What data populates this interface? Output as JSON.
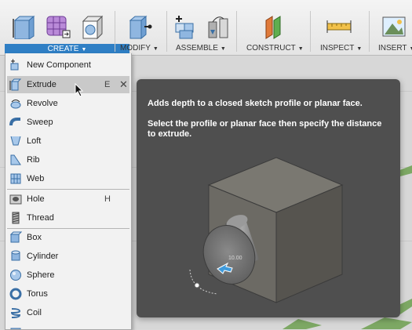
{
  "toolbar": {
    "create_label": "CREATE",
    "modify_label": "MODIFY",
    "assemble_label": "ASSEMBLE",
    "construct_label": "CONSTRUCT",
    "inspect_label": "INSPECT",
    "insert_label": "INSERT",
    "accent_color": "#2f7fc5"
  },
  "menu": {
    "items": [
      {
        "label": "New Component",
        "icon": "new-component-icon"
      },
      {
        "label": "Extrude",
        "shortcut": "E",
        "icon": "extrude-icon",
        "active": true
      },
      {
        "label": "Revolve",
        "icon": "revolve-icon"
      },
      {
        "label": "Sweep",
        "icon": "sweep-icon"
      },
      {
        "label": "Loft",
        "icon": "loft-icon"
      },
      {
        "label": "Rib",
        "icon": "rib-icon"
      },
      {
        "label": "Web",
        "icon": "web-icon"
      },
      {
        "label": "Hole",
        "shortcut": "H",
        "icon": "hole-icon"
      },
      {
        "label": "Thread",
        "icon": "thread-icon"
      },
      {
        "label": "Box",
        "icon": "box-icon"
      },
      {
        "label": "Cylinder",
        "icon": "cylinder-icon"
      },
      {
        "label": "Sphere",
        "icon": "sphere-icon"
      },
      {
        "label": "Torus",
        "icon": "torus-icon"
      },
      {
        "label": "Coil",
        "icon": "coil-icon"
      }
    ],
    "close_glyph": "✕"
  },
  "tooltip": {
    "line1": "Adds depth to a closed sketch profile or planar face.",
    "line2": "Select the profile or planar face then specify the distance to extrude.",
    "dimension_value": "10.00",
    "background": "#4f4f4f"
  }
}
